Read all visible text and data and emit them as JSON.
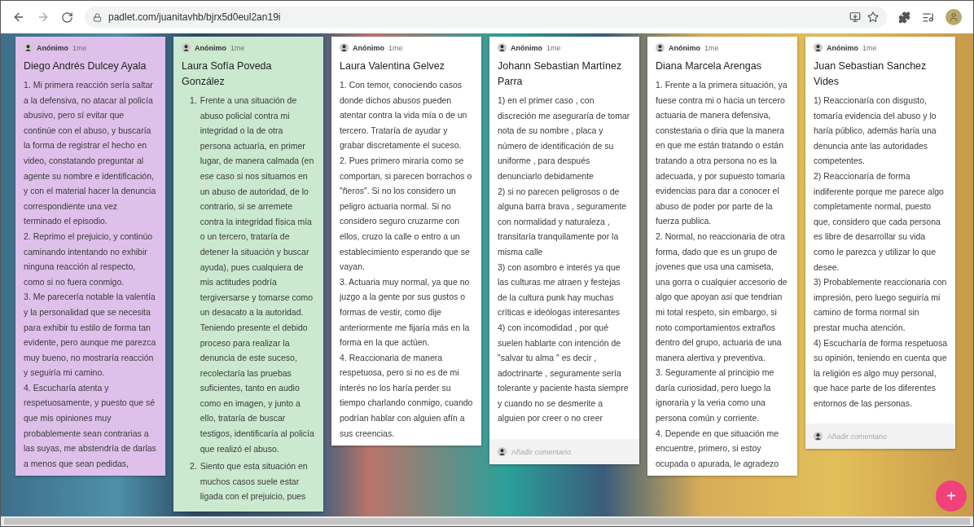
{
  "browser": {
    "url": "padlet.com/juanitavhb/bjrx5d0eul2an19i"
  },
  "cards": [
    {
      "color": "#dfc0ea",
      "author": "Anónimo",
      "time": "1me",
      "title": "Diego Andrés Dulcey Ayala",
      "paragraphs": [
        {
          "text": "1.  Mi primera reacción sería saltar a la defensiva, no atacar al policía abusivo, pero sí evitar que continúe con el abuso, y buscaría la forma de registrar el hecho en video, constatando preguntar al agente su nombre e identificación, y con el material hacer la denuncia correspondiente una vez terminado el episodio."
        },
        {
          "text": "2. Reprimo el prejuicio, y continúo caminando intentando no exhibir ninguna reacción al respecto, como si no fuera conmigo."
        },
        {
          "text": "3. Me parecería notable la valentía y la personalidad que se necesita para exhibir tu estilo de forma tan evidente, pero aunque me parezca muy bueno, no mostraría reacción y seguiría mi camino."
        },
        {
          "text": "4. Escucharía atenta y respetuosamente, y puesto que sé que mis opiniones muy probablemente sean contrarias a las suyas, me abstendría de darlas a menos que sean pedidas,"
        }
      ]
    },
    {
      "color": "#cbe9cf",
      "author": "Anónimo",
      "time": "1me",
      "title": "Laura Sofía Poveda González",
      "paragraphs": [
        {
          "marker": "1.",
          "text": "Frente a una situación de abuso policial contra mi integridad o la de otra persona actuaría, en primer lugar, de manera calmada (en ese caso si nos situamos en un abuso de autoridad, de lo contrario, si se arremete contra la integridad física mía o un tercero, trataría de detener la situación y buscar ayuda), pues cualquiera de mis actitudes podría tergiversarse y tomarse como un desacato a la autoridad. Teniendo presente el debido proceso para realizar la denuncia de este suceso, recolectaría las pruebas suficientes, tanto en audio como en imagen, y junto a ello, trataría de buscar testigos, identificaría al policía que realizó el abuso."
        },
        {
          "marker": "2.",
          "text": "Siento que esta situación en muchos casos suele estar ligada con el prejuicio, pues"
        }
      ]
    },
    {
      "color": "#ffffff",
      "author": "Anónimo",
      "time": "1me",
      "title": "Laura Valentina Gelvez",
      "paragraphs": [
        {
          "text": "1. Con temor, conociendo casos donde dichos abusos pueden atentar contra la vida mía o de un tercero. Trataría de ayudar y grabar discretamente el suceso."
        },
        {
          "text": "2. Pues primero miraría como se comportan, si parecen borrachos o \"ñeros\". Si no los considero un peligro actuaria normal. Si no considero seguro cruzarme con ellos, cruzo la calle o entro a un establecimiento esperando que se vayan."
        },
        {
          "text": "3. Actuaria muy normal, ya que no juzgo a la gente por sus gustos o formas de vestir, como dije anteriormente me fijaría más en la forma en la que actúen."
        },
        {
          "text": "4. Reaccionaria de manera respetuosa, pero si no es de mi interés no los haría perder su tiempo charlando conmigo, cuando podrían hablar con alguien afín a sus creencias."
        }
      ]
    },
    {
      "color": "#ffffff",
      "author": "Anónimo",
      "time": "1me",
      "title": "Johann Sebastian Martínez Parra",
      "comment_placeholder": "Añadir comentario",
      "paragraphs": [
        {
          "text": "1) en el primer caso , con discreción me aseguraría de tomar nota de su nombre , placa y número de identificación de su uniforme , para después denunciarlo debidamente"
        },
        {
          "text": "2) si no parecen peligrosos o de alguna barra brava , seguramente con normalidad y naturaleza , transitaría tranquilamente por la misma calle"
        },
        {
          "text": "3) con asombro e interés ya que las culturas me atraen y festejas de la cultura punk hay muchas críticas e ideólogas interesantes"
        },
        {
          "text": "4) con incomodidad , por qué suelen hablarte con intención de \"salvar tu alma \" es decir , adoctrinarte , seguramente sería tolerante y paciente hasta siempre y cuando no se desmerite a alguien por creer o no creer"
        }
      ]
    },
    {
      "color": "#ffffff",
      "author": "Anónimo",
      "time": "1me",
      "title": "Diana Marcela Arengas",
      "paragraphs": [
        {
          "text": "1. Frente a la primera situación, ya fuese contra mi o hacia un tercero actuaria de manera defensiva, constestaria o diria que la manera en que me están tratando o están tratando a otra persona no es la adecuada, y por supuesto tomaria evidencias para dar a conocer el abuso de poder por parte de la fuerza publica."
        },
        {
          "text": "2.  Normal, no reaccionaria de otra forma, dado que es un grupo de jovenes que usa una camiseta, una gorra o cualquier accesorio de algo que apoyan asi que tendrian  mi total respeto, sin embargo, si noto comportamientos extraños dentro del grupo, actuaria de una manera alertiva y preventiva."
        },
        {
          "text": "3. Seguramente al principio me daría curiosidad, pero luego la ignoraria y la veria como una persona común y corriente."
        },
        {
          "text": "4. Depende en que situación me encuentre, primero, si estoy ocupada o apurada, le agradezo"
        }
      ]
    },
    {
      "color": "#ffffff",
      "author": "Anónimo",
      "time": "1me",
      "title": "Juan Sebastian Sanchez Vides",
      "comment_placeholder": "Añadir comentario",
      "paragraphs": [
        {
          "text": "1) Reaccionaría con disgusto, tomaría evidencia del abuso y lo haría público, además haría una denuncia ante las autoridades competentes."
        },
        {
          "text": "2) Reaccionaría de forma indiferente porque me parece algo completamente normal, puesto que, considero que cada persona es libre de desarrollar su vida como le parezca y utilizar lo que desee."
        },
        {
          "text": "3) Probablemente reaccionaria con impresión, pero luego seguiría mi camino de forma normal sin prestar mucha atención."
        },
        {
          "text": "4) Escucharía de forma respetuosa su opinión, teniendo en cuenta que la religión es algo muy personal, que hace parte de los diferentes entornos de las personas."
        }
      ]
    }
  ],
  "fab": {
    "label": "+"
  }
}
